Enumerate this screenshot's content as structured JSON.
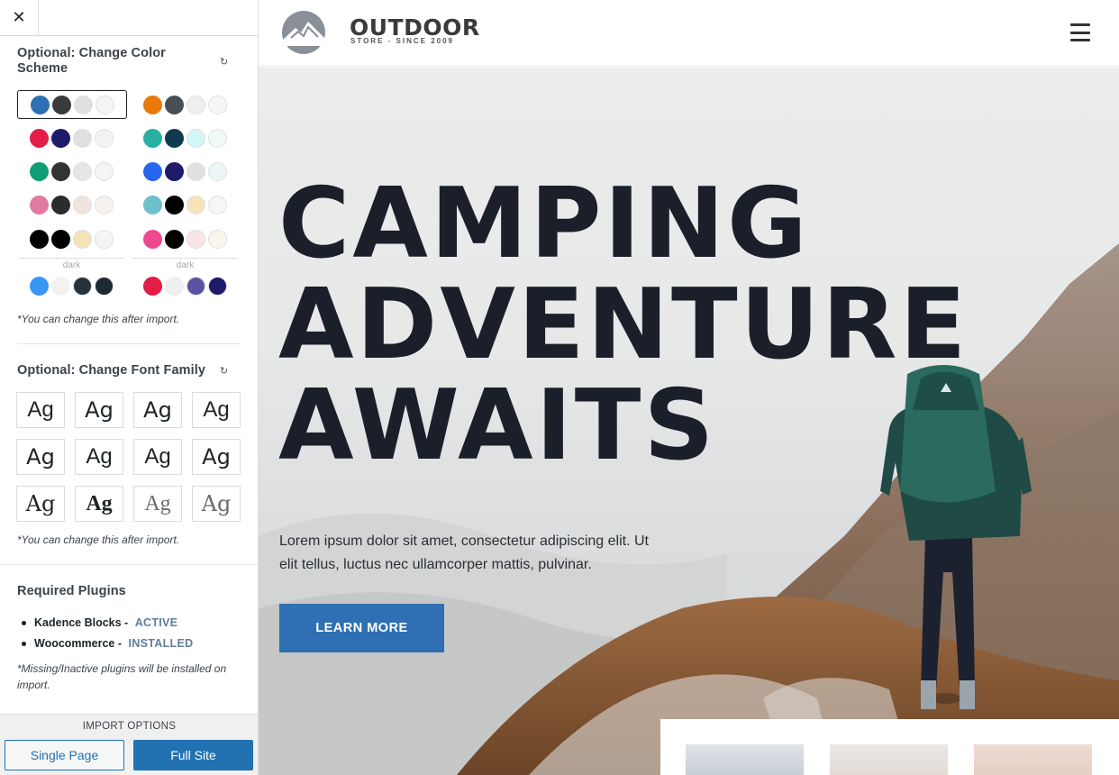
{
  "sidebar": {
    "close_symbol": "✕",
    "color_section": {
      "title": "Optional: Change Color Scheme",
      "reset_icon": "↻",
      "palettes_left": [
        [
          "#2f6fb3",
          "#3a3a3a",
          "#e0e0e0",
          "#f5f5f5"
        ],
        [
          "#e11d48",
          "#1e1b6b",
          "#e0e0e0",
          "#f2f2f2"
        ],
        [
          "#0f9d74",
          "#333333",
          "#e6e6e6",
          "#f5f5f5"
        ],
        [
          "#e07aa0",
          "#2c2c2c",
          "#f1e4de",
          "#f7f2ef"
        ],
        [
          "#000000",
          "#000000",
          "#f3e3b6",
          "#f5f5f5"
        ]
      ],
      "palettes_right": [
        [
          "#e8790a",
          "#474f55",
          "#eeeeee",
          "#f6f6f6"
        ],
        [
          "#2ab0a3",
          "#0f3b4f",
          "#d3f6f7",
          "#f0f8f8"
        ],
        [
          "#2866f0",
          "#1e1b6b",
          "#e0e0e0",
          "#eef5f7"
        ],
        [
          "#6fc0cd",
          "#000000",
          "#f6e4b9",
          "#f6f6f6"
        ],
        [
          "#f0488f",
          "#000000",
          "#f8e6e6",
          "#fbf4ea"
        ]
      ],
      "dark_label": "dark",
      "dark_left": [
        "#3996f5",
        "#f2f2f2",
        "#27323d",
        "#1f2933"
      ],
      "dark_right": [
        "#e11d48",
        "#eeeeee",
        "#5a53a0",
        "#1e1b6b"
      ],
      "note": "*You can change this after import."
    },
    "font_section": {
      "title": "Optional: Change Font Family",
      "reset_icon": "↻",
      "sample": "Ag",
      "note": "*You can change this after import."
    },
    "plugins": {
      "title": "Required Plugins",
      "items": [
        {
          "name": "Kadence Blocks",
          "separator": " - ",
          "status": "ACTIVE"
        },
        {
          "name": "Woocommerce",
          "separator": " - ",
          "status": "INSTALLED"
        }
      ],
      "note": "*Missing/Inactive plugins will be installed on import."
    },
    "import": {
      "label": "IMPORT OPTIONS",
      "single": "Single Page",
      "full": "Full Site"
    }
  },
  "preview": {
    "logo": {
      "name": "OUTDOOR",
      "tagline": "STORE - SINCE 2009"
    },
    "menu_icon": "hamburger-icon",
    "hero": {
      "headline": [
        "CAMPING",
        "ADVENTURE",
        "AWAITS"
      ],
      "body": "Lorem ipsum dolor sit amet, consectetur adipiscing elit. Ut elit tellus, luctus nec ullamcorper mattis, pulvinar.",
      "button": "LEARN MORE"
    },
    "colors": {
      "accent": "#2f6fb3",
      "heading": "#1b1f2a"
    }
  }
}
